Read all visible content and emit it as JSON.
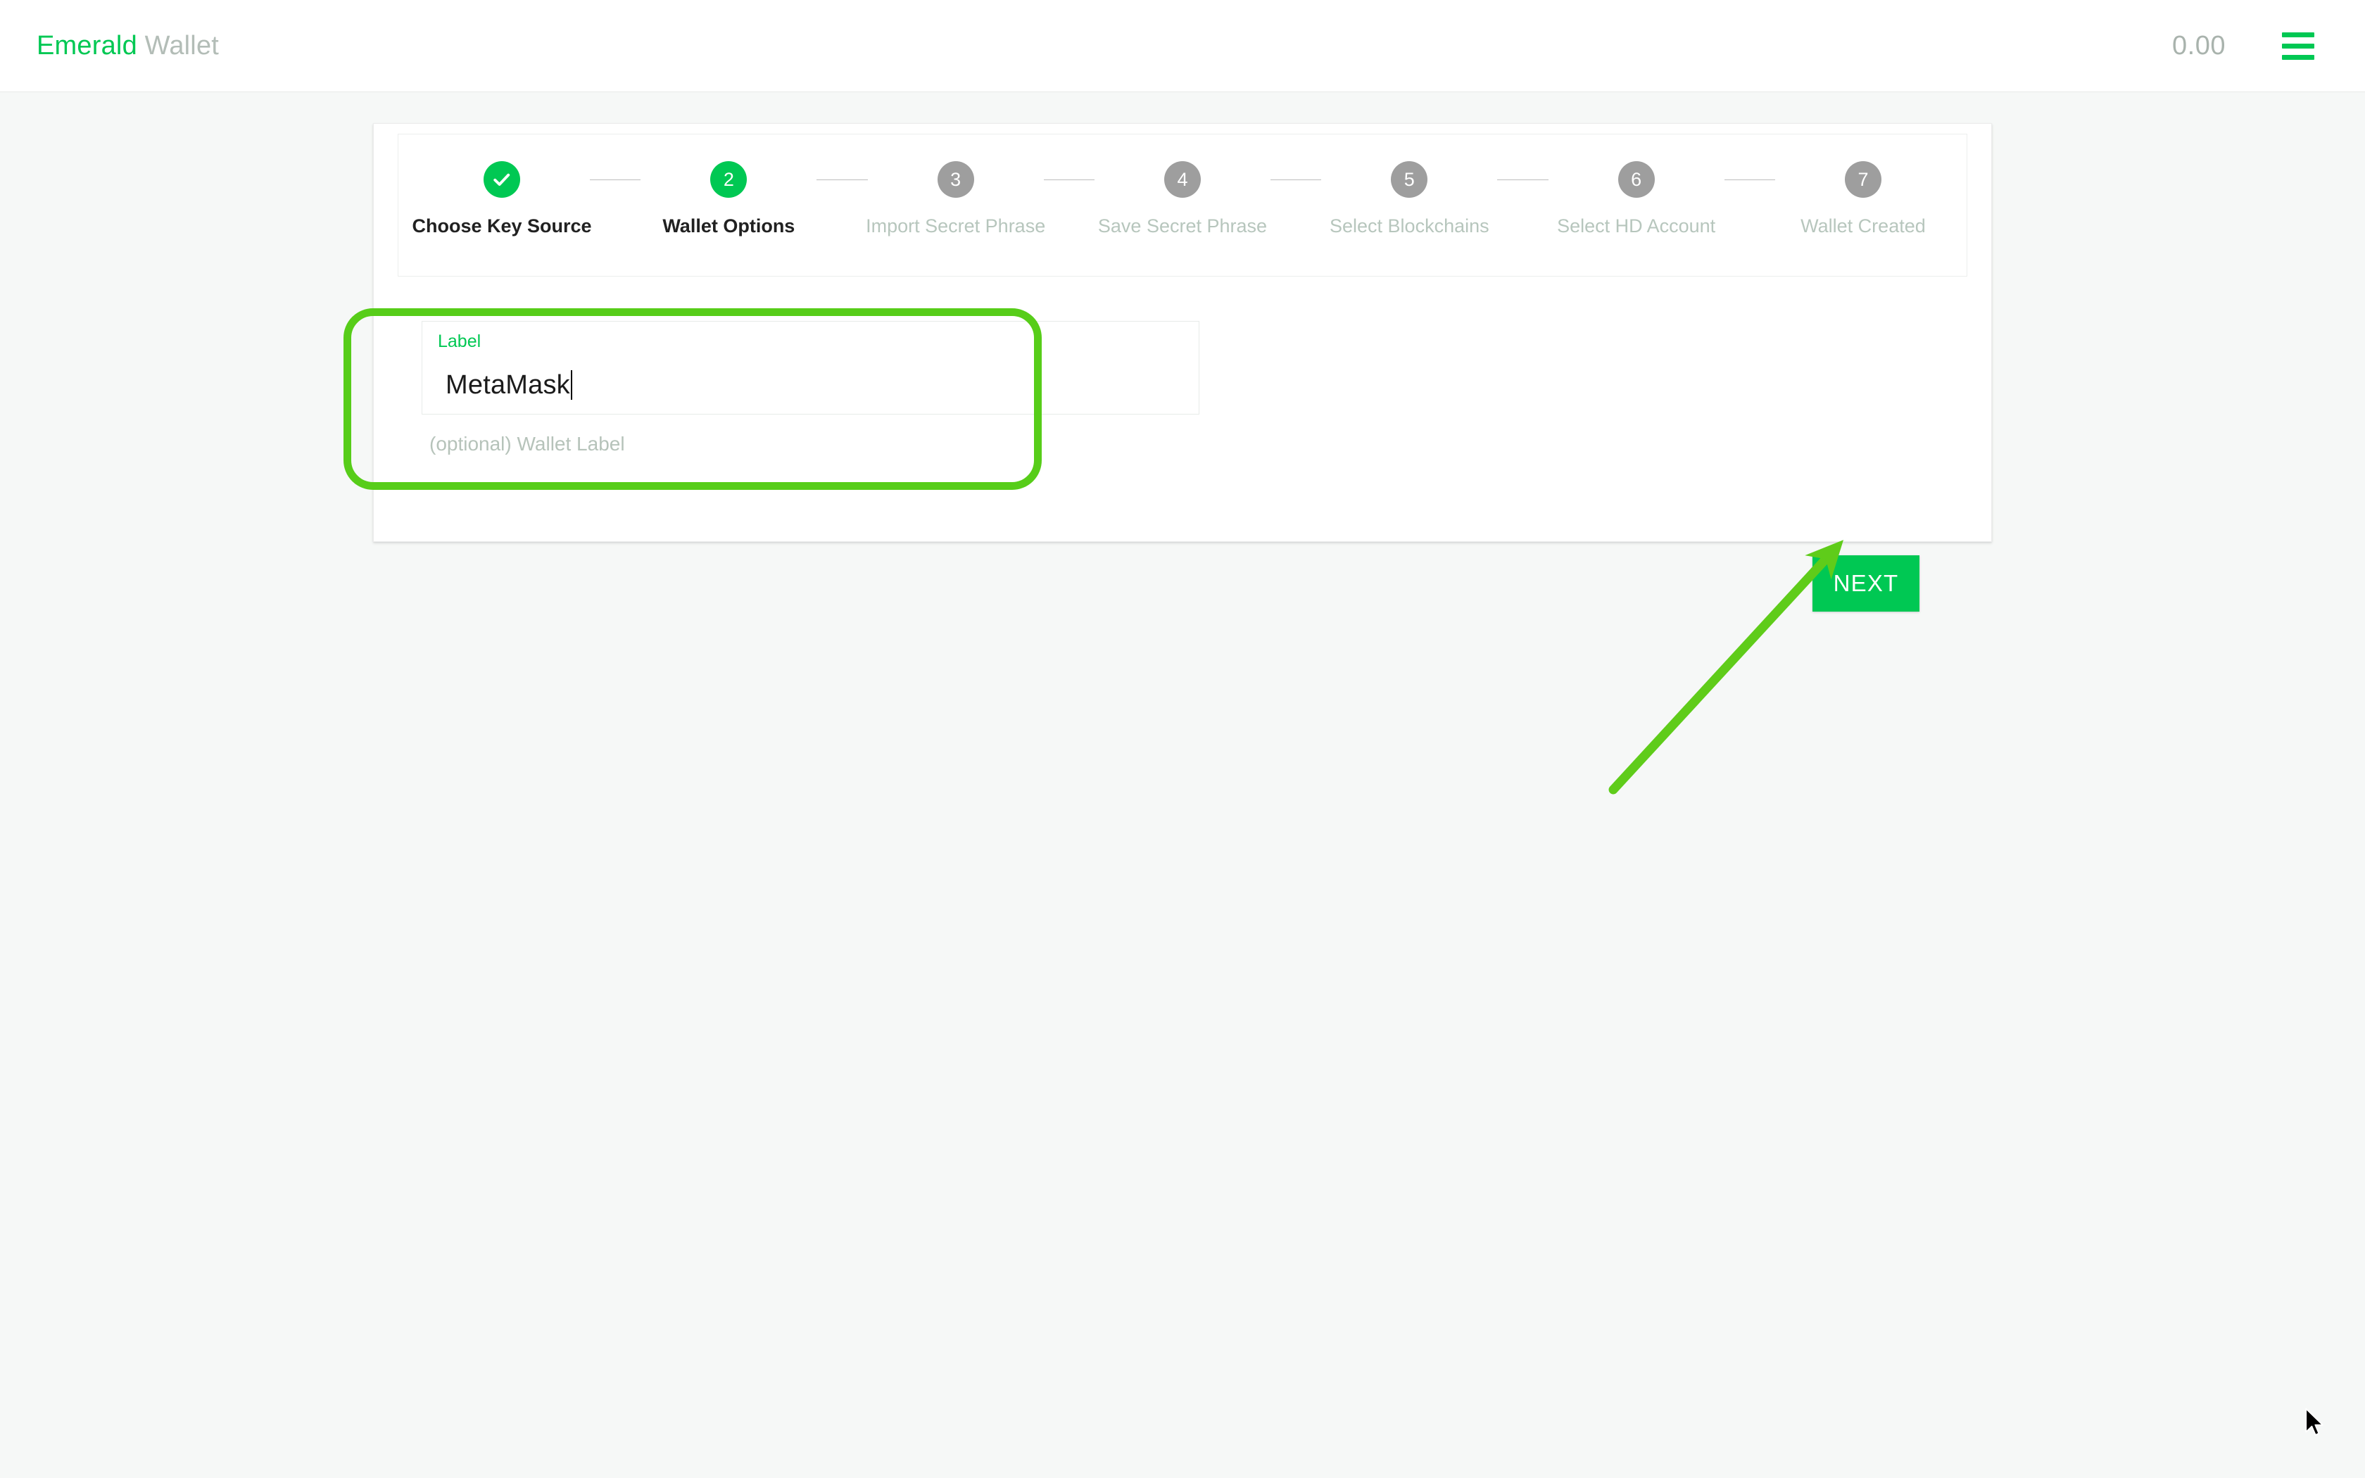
{
  "header": {
    "brand_primary": "Emerald",
    "brand_secondary": "Wallet",
    "balance": "0.00",
    "menu_icon": "hamburger-menu-icon",
    "accent_color": "#00c853",
    "brand_secondary_color": "#b3bdb7"
  },
  "wizard": {
    "steps": [
      {
        "number": "✓",
        "label": "Choose Key Source",
        "state": "done"
      },
      {
        "number": "2",
        "label": "Wallet Options",
        "state": "active"
      },
      {
        "number": "3",
        "label": "Import Secret Phrase",
        "state": "pending"
      },
      {
        "number": "4",
        "label": "Save Secret Phrase",
        "state": "pending"
      },
      {
        "number": "5",
        "label": "Select Blockchains",
        "state": "pending"
      },
      {
        "number": "6",
        "label": "Select HD Account",
        "state": "pending"
      },
      {
        "number": "7",
        "label": "Wallet Created",
        "state": "pending"
      }
    ]
  },
  "form": {
    "label_legend": "Label",
    "label_value": "MetaMask",
    "label_placeholder": "",
    "label_help": "(optional) Wallet Label"
  },
  "actions": {
    "next_label": "NEXT"
  },
  "annotations": {
    "highlight_color": "#57cd19",
    "arrow_color": "#5fcc1a",
    "arrow_target": "next-button"
  },
  "colors": {
    "page_background": "#f6f8f7",
    "card_background": "#ffffff",
    "step_pending": "#9e9e9e",
    "step_active": "#00c853",
    "muted_text": "#b7c6bd"
  }
}
